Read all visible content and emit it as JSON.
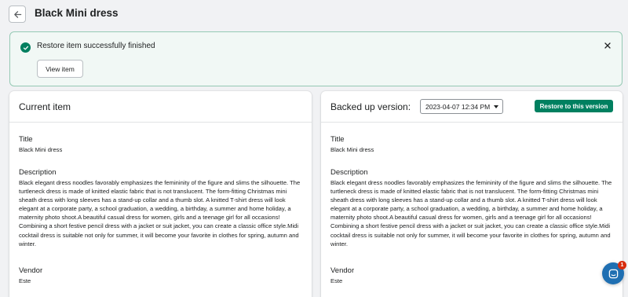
{
  "header": {
    "title": "Black Mini dress"
  },
  "banner": {
    "message": "Restore item successfully finished",
    "view_button": "View item"
  },
  "current": {
    "heading": "Current item",
    "title_label": "Title",
    "title_value": "Black Mini dress",
    "description_label": "Description",
    "description_value": "Black elegant dress noodles favorably emphasizes the femininity of the figure and slims the silhouette. The turtleneck dress is made of knitted elastic fabric that is not translucent. The form-fitting Christmas mini sheath dress with long sleeves has a stand-up collar and a thumb slot. A knitted T-shirt dress will look elegant at a corporate party, a school graduation, a wedding, a birthday, a summer and home holiday, a maternity photo shoot.A beautiful casual dress for women, girls and a teenage girl for all occasions! Combining a short festive pencil dress with a jacket or suit jacket, you can create a classic office style.Midi cocktail dress is suitable not only for summer, it will become your favorite in clothes for spring, autumn and winter.",
    "vendor_label": "Vendor",
    "vendor_value": "Este"
  },
  "backup": {
    "heading": "Backed up version:",
    "date_selected": "2023-04-07 12:34 PM",
    "restore_button": "Restore to this version",
    "title_label": "Title",
    "title_value": "Black Mini dress",
    "description_label": "Description",
    "description_value": "Black elegant dress noodles favorably emphasizes the femininity of the figure and slims the silhouette. The turtleneck dress is made of knitted elastic fabric that is not translucent. The form-fitting Christmas mini sheath dress with long sleeves has a stand-up collar and a thumb slot. A knitted T-shirt dress will look elegant at a corporate party, a school graduation, a wedding, a birthday, a summer and home holiday, a maternity photo shoot.A beautiful casual dress for women, girls and a teenage girl for all occasions! Combining a short festive pencil dress with a jacket or suit jacket, you can create a classic office style.Midi cocktail dress is suitable not only for summer, it will become your favorite in clothes for spring, autumn and winter.",
    "vendor_label": "Vendor",
    "vendor_value": "Este"
  },
  "chat": {
    "badge": "1"
  },
  "colors": {
    "primary": "#008060",
    "success_bg": "#f1f8f5",
    "success_icon": "#007f5f",
    "chat": "#1f6fb2"
  },
  "icons": [
    "arrow-left-icon",
    "check-circle-icon",
    "close-icon",
    "chevron-down-icon",
    "chat-icon"
  ]
}
